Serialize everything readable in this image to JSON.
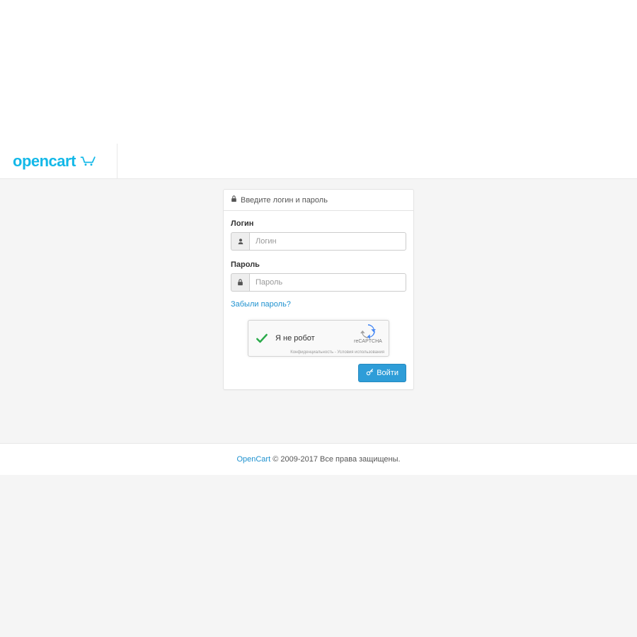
{
  "header": {
    "logo_text": "opencart"
  },
  "panel": {
    "heading": "Введите логин и пароль"
  },
  "form": {
    "login_label": "Логин",
    "login_placeholder": "Логин",
    "password_label": "Пароль",
    "password_placeholder": "Пароль",
    "forgot_text": "Забыли пароль?"
  },
  "captcha": {
    "text": "Я не робот",
    "brand": "reCAPTCHA",
    "privacy": "Конфиденциальность - Условия использования"
  },
  "button": {
    "login": "Войти"
  },
  "footer": {
    "link_text": "OpenCart",
    "copyright": " © 2009-2017 Все права защищены."
  }
}
